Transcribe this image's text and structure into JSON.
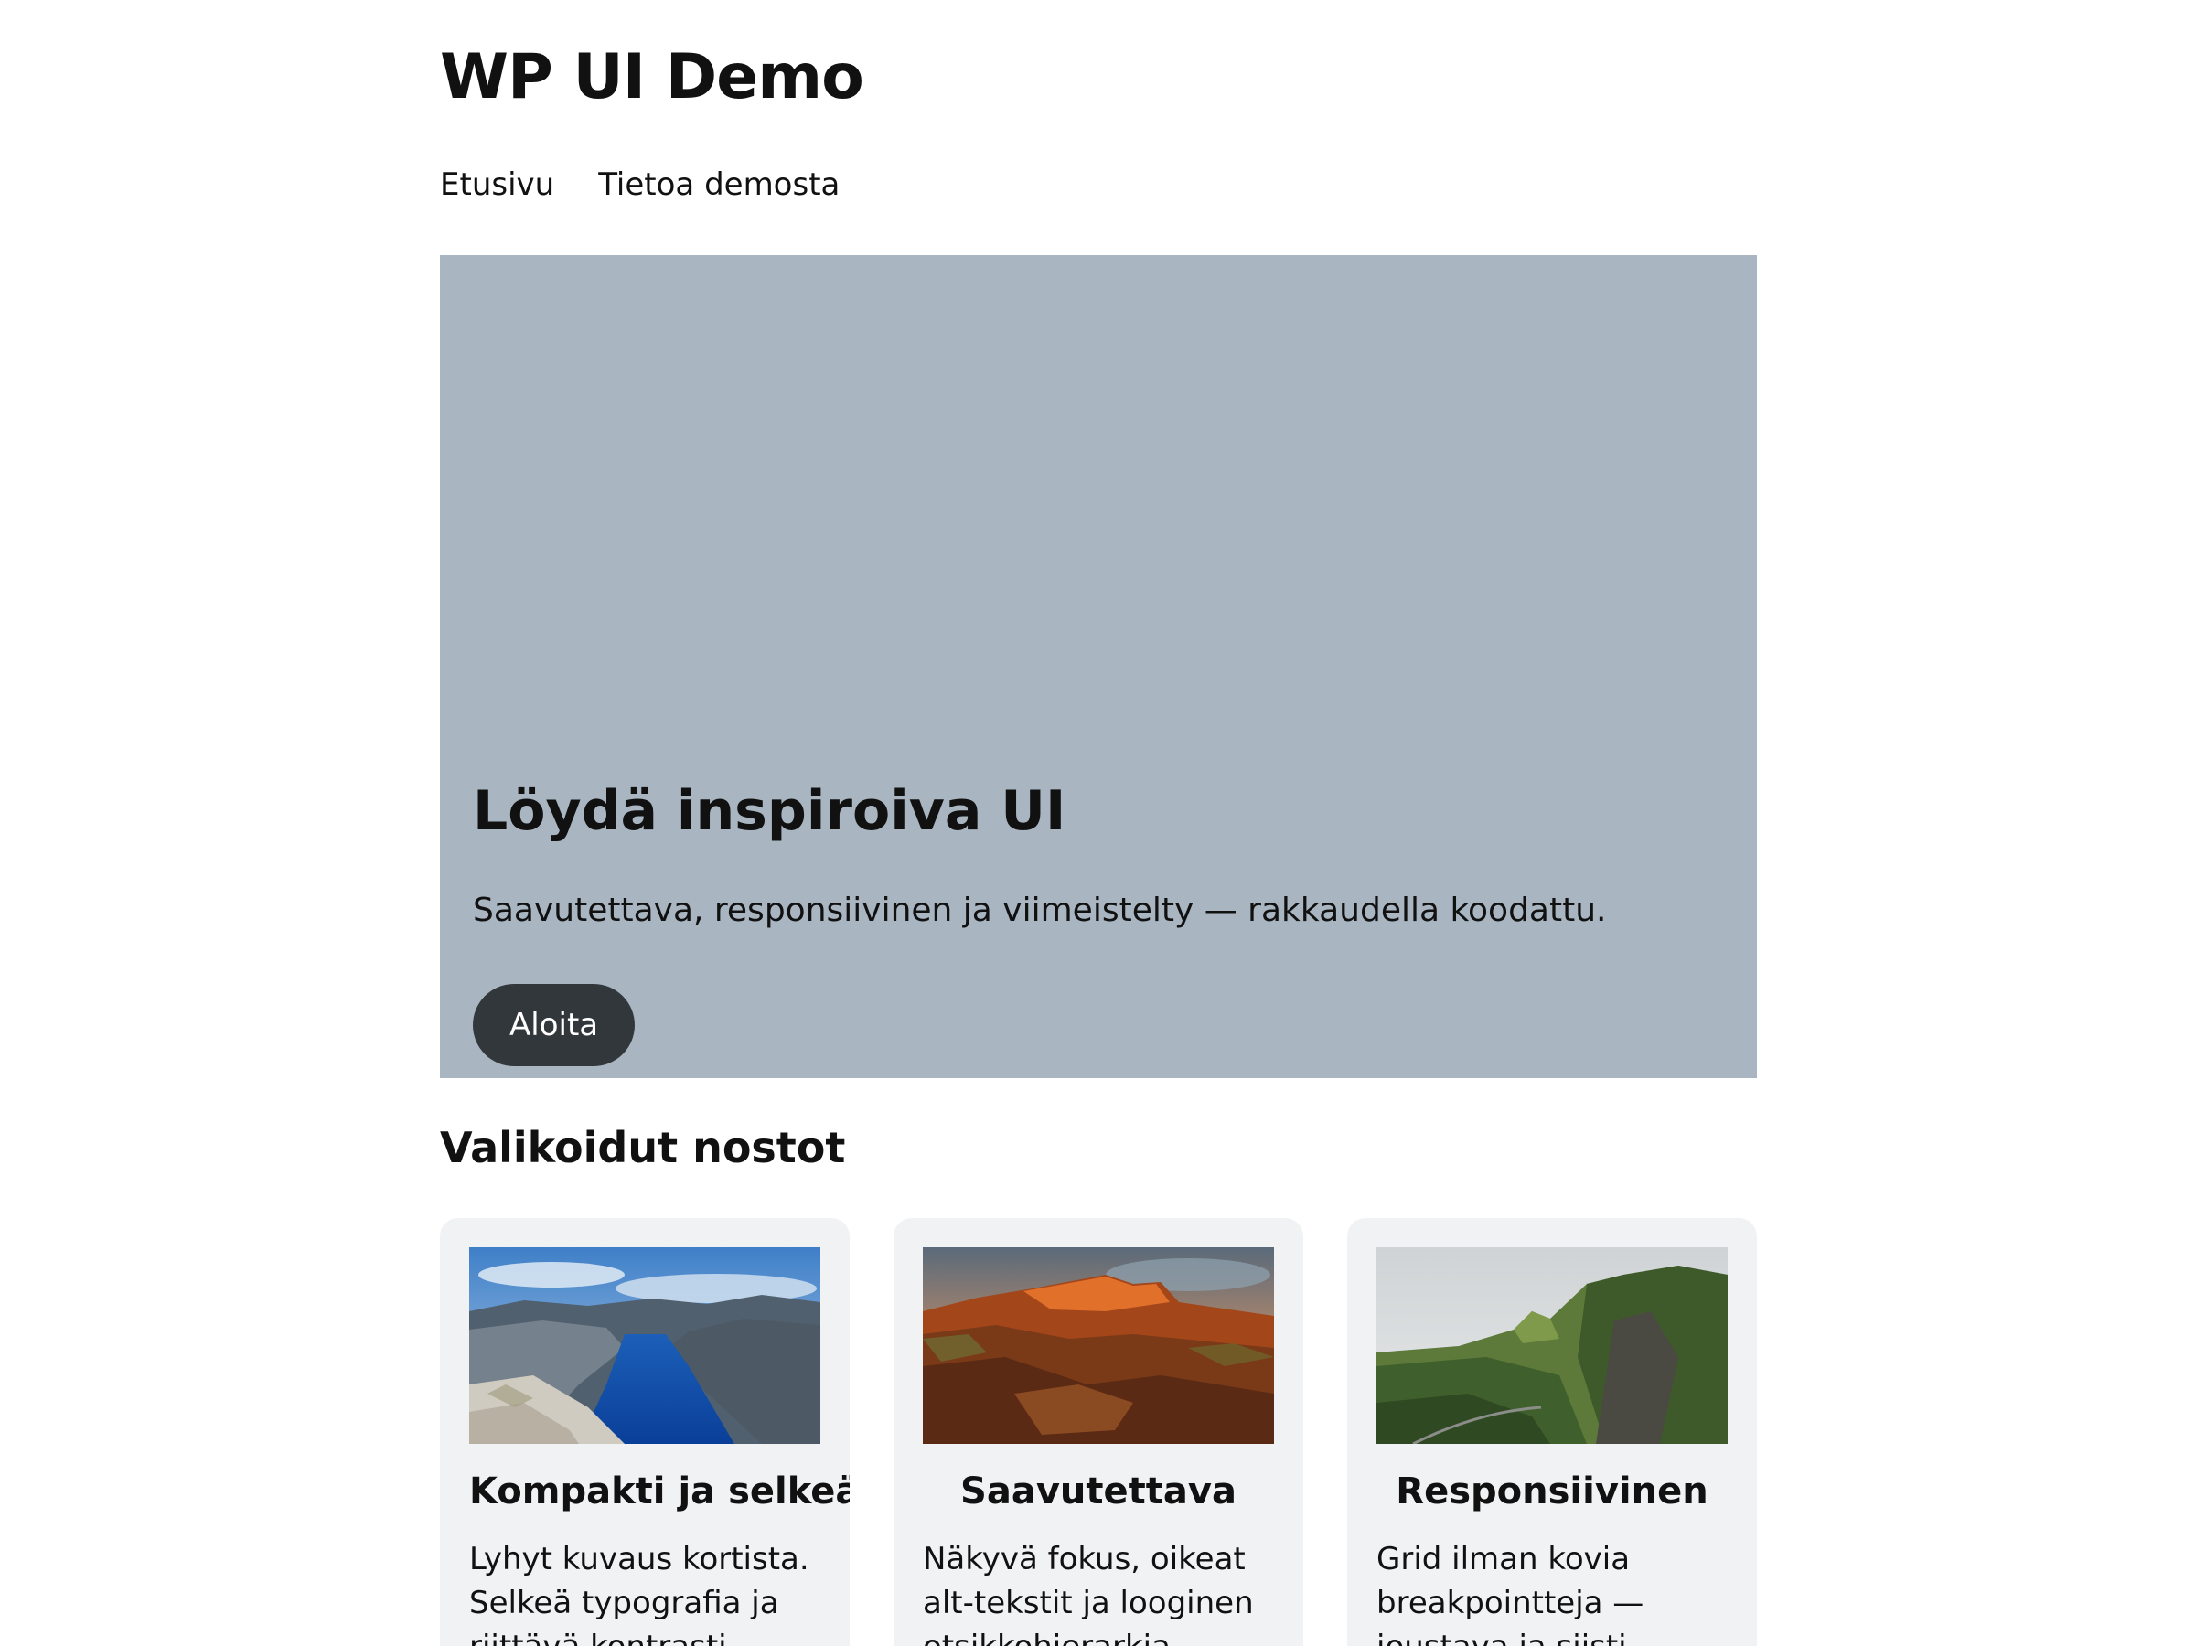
{
  "site": {
    "title": "WP UI Demo"
  },
  "nav": {
    "items": [
      {
        "label": "Etusivu"
      },
      {
        "label": "Tietoa demosta"
      }
    ]
  },
  "hero": {
    "title": "Löydä inspiroiva UI",
    "text": "Saavutettava, responsiivinen ja viimeistelty — rakkaudella koodattu.",
    "button_label": "Aloita",
    "background_color": "#a9b6c2",
    "button_color": "#32373c"
  },
  "featured": {
    "title": "Valikoidut nostot",
    "cards": [
      {
        "title": "Kompakti ja selkeä",
        "text": "Lyhyt kuvaus kortista. Selkeä typografia ja riittävä kontrasti.",
        "image": "fjord-landscape-photo"
      },
      {
        "title": "Saavutettava",
        "text": "Näkyvä fokus, oikeat alt-tekstit ja looginen otsikkohierarkia.",
        "image": "red-rock-canyon-photo"
      },
      {
        "title": "Responsiivinen",
        "text": "Grid ilman kovia breakpointteja — joustava ja siisti.",
        "image": "green-hills-road-photo"
      }
    ]
  }
}
